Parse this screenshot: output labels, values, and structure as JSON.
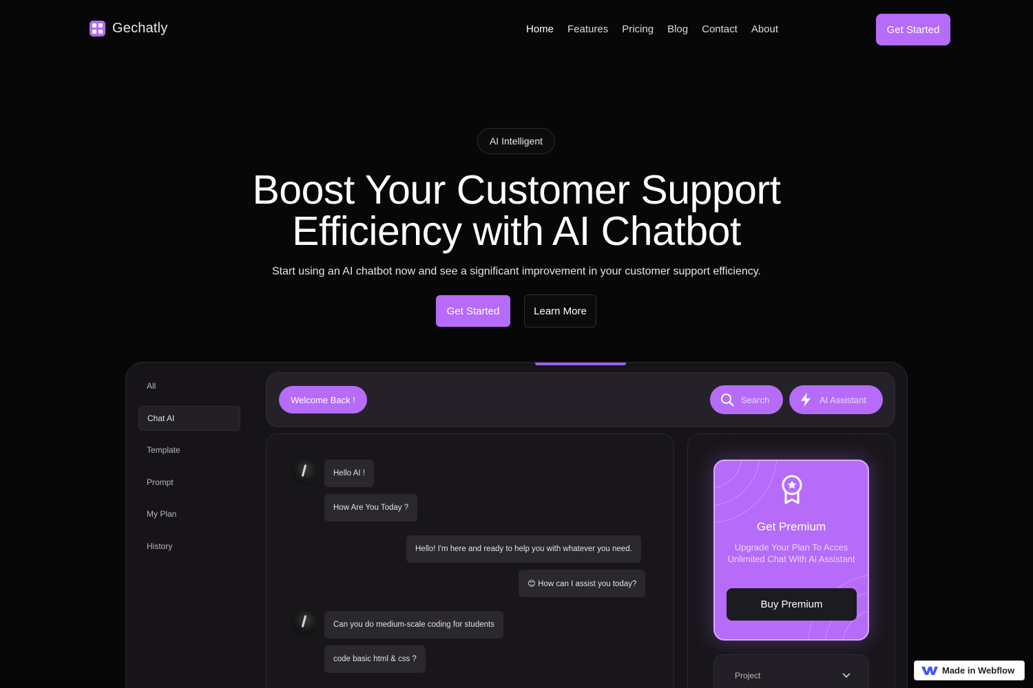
{
  "brand": {
    "name": "Gechatly",
    "accent": "#b66cf8"
  },
  "nav": {
    "links": [
      "Home",
      "Features",
      "Pricing",
      "Blog",
      "Contact",
      "About"
    ],
    "active": "Home",
    "cta": "Get Started"
  },
  "hero": {
    "badge": "AI Intelligent",
    "title_line1": "Boost Your Customer Support",
    "title_line2": "Efficiency with AI Chatbot",
    "subtitle": "Start using an AI chatbot now and see a significant improvement in your customer support efficiency.",
    "primary_button": "Get Started",
    "secondary_button": "Learn More"
  },
  "app": {
    "sidebar": [
      "All",
      "Chat AI",
      "Template",
      "Prompt",
      "My Plan",
      "History"
    ],
    "sidebar_active": "Chat AI",
    "topbar": {
      "welcome": "Welcome Back !",
      "search": "Search",
      "assistant": "AI Assistant"
    },
    "messages": [
      {
        "from": "user",
        "text": "Hello AI !"
      },
      {
        "from": "user",
        "text": "How Are You Today ?"
      },
      {
        "from": "bot",
        "text": "Hello! I'm here and ready to help you with whatever you need."
      },
      {
        "from": "bot",
        "text": "😊 How can I assist you today?"
      },
      {
        "from": "user",
        "text": "Can you do medium-scale coding for students"
      },
      {
        "from": "user",
        "text": "code basic html & css ?"
      }
    ],
    "premium": {
      "title": "Get Premium",
      "description": "Upgrade Your Plan To Acces Unlimited Chat With Ai Assistant",
      "button": "Buy Premium"
    },
    "project_select": "Project"
  },
  "webflow_badge": "Made in Webflow",
  "icons": [
    "logo-icon",
    "search-icon",
    "lightning-icon",
    "award-icon",
    "chevron-down-icon",
    "webflow-icon"
  ]
}
